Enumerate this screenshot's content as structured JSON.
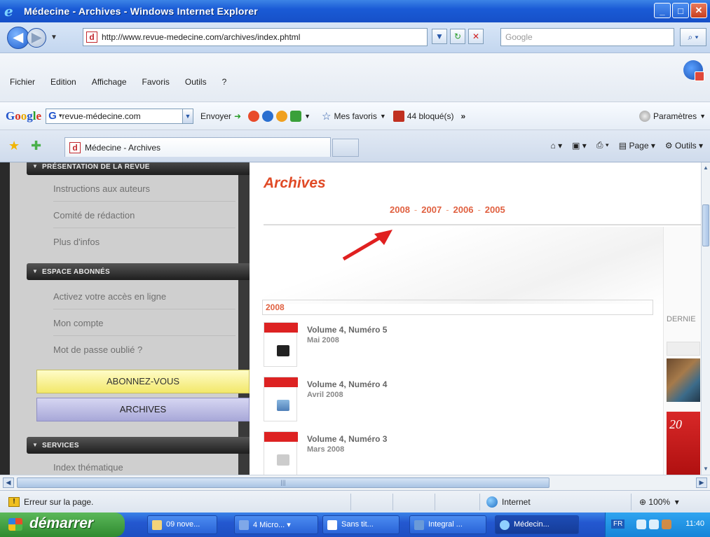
{
  "window": {
    "title": "Médecine - Archives - Windows Internet Explorer"
  },
  "address": {
    "url": "http://www.revue-medecine.com/archives/index.phtml",
    "search_placeholder": "Google"
  },
  "menu": [
    "Fichier",
    "Edition",
    "Affichage",
    "Favoris",
    "Outils",
    "?"
  ],
  "googlebar": {
    "field": "revue-médecine.com",
    "send": "Envoyer",
    "favorites": "Mes favoris",
    "blocked": "44 bloqué(s)",
    "more": "»",
    "settings": "Paramètres"
  },
  "tab": {
    "title": "Médecine - Archives",
    "page_menu": "Page",
    "tools_menu": "Outils"
  },
  "sidebar": {
    "section1": "PRÉSENTATION DE LA REVUE",
    "links1": [
      "Instructions aux auteurs",
      "Comité de rédaction",
      "Plus d'infos"
    ],
    "section2": "ESPACE ABONNÉS",
    "links2": [
      "Activez votre accès en ligne",
      "Mon compte",
      "Mot de passe oublié ?"
    ],
    "btn_subscribe": "ABONNEZ-VOUS",
    "btn_archives": "ARCHIVES",
    "section3": "SERVICES",
    "links3": [
      "Index thématique"
    ]
  },
  "main": {
    "title": "Archives",
    "years": [
      "2008",
      "2007",
      "2006",
      "2005"
    ],
    "year_header": "2008",
    "issues": [
      {
        "volume": "Volume 4, Numéro 5",
        "date": "Mai 2008"
      },
      {
        "volume": "Volume 4, Numéro 4",
        "date": "Avril 2008"
      },
      {
        "volume": "Volume 4, Numéro 3",
        "date": "Mars 2008"
      }
    ],
    "right_label": "DERNIE"
  },
  "status": {
    "text": "Erreur sur la page.",
    "zone": "Internet",
    "zoom": "100%"
  },
  "taskbar": {
    "start": "démarrer",
    "tasks": [
      "09 nove...",
      "4 Micro...",
      "Sans tit...",
      "Integral ...",
      "Médecin..."
    ],
    "lang": "FR",
    "time": "11:40"
  }
}
